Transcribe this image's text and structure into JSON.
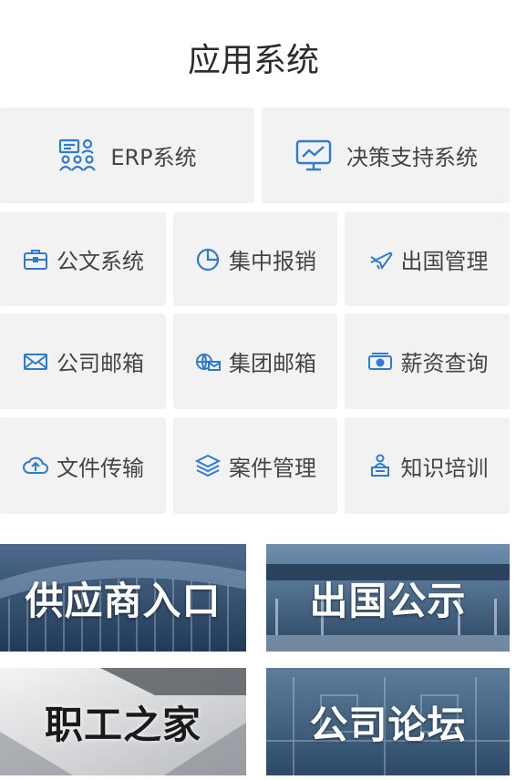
{
  "section_title": "应用系统",
  "colors": {
    "tile_bg": "#f2f2f2",
    "icon_blue": "#2f7bd1",
    "label": "#444444"
  },
  "top_tiles": [
    {
      "label": "ERP系统",
      "icon": "team-icon"
    },
    {
      "label": "决策支持系统",
      "icon": "presentation-chart-icon"
    }
  ],
  "grid_tiles": [
    {
      "label": "公文系统",
      "icon": "briefcase-icon"
    },
    {
      "label": "集中报销",
      "icon": "pie-chart-icon"
    },
    {
      "label": "出国管理",
      "icon": "airplane-icon"
    },
    {
      "label": "公司邮箱",
      "icon": "envelope-icon"
    },
    {
      "label": "集团邮箱",
      "icon": "email-globe-icon"
    },
    {
      "label": "薪资查询",
      "icon": "money-icon"
    },
    {
      "label": "文件传输",
      "icon": "cloud-upload-icon"
    },
    {
      "label": "案件管理",
      "icon": "layers-icon"
    },
    {
      "label": "知识培训",
      "icon": "lecturer-icon"
    }
  ],
  "banners": [
    {
      "label": "供应商入口",
      "theme": "dark-blue"
    },
    {
      "label": "出国公示",
      "theme": "dark-blue"
    },
    {
      "label": "职工之家",
      "theme": "light-gray"
    },
    {
      "label": "公司论坛",
      "theme": "dark-blue"
    }
  ]
}
